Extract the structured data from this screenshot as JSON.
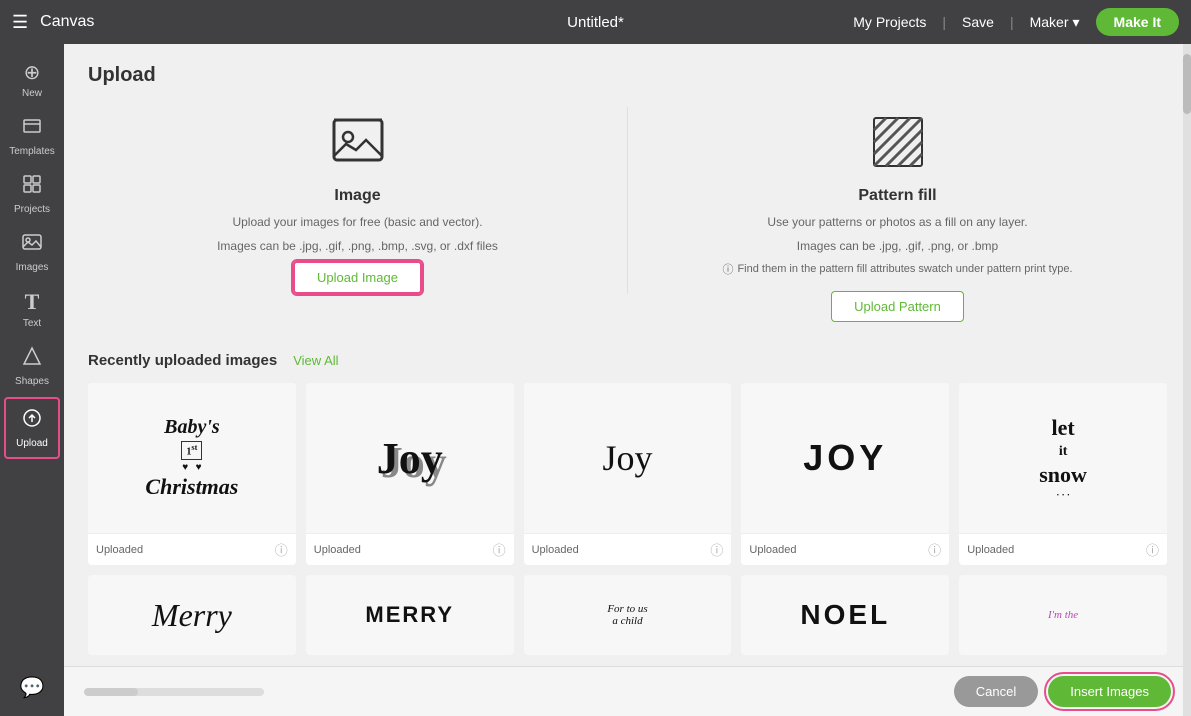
{
  "topbar": {
    "logo": "Canvas",
    "title": "Untitled*",
    "my_projects": "My Projects",
    "save": "Save",
    "maker_label": "Maker",
    "make_it": "Make It",
    "menu_icon": "☰"
  },
  "sidebar": {
    "items": [
      {
        "id": "new",
        "label": "New",
        "icon": "⊕"
      },
      {
        "id": "templates",
        "label": "Templates",
        "icon": "👕"
      },
      {
        "id": "projects",
        "label": "Projects",
        "icon": "⊞"
      },
      {
        "id": "images",
        "label": "Images",
        "icon": "🖼"
      },
      {
        "id": "text",
        "label": "Text",
        "icon": "T"
      },
      {
        "id": "shapes",
        "label": "Shapes",
        "icon": "✦"
      },
      {
        "id": "upload",
        "label": "Upload",
        "icon": "↑"
      }
    ]
  },
  "upload": {
    "title": "Upload",
    "image": {
      "title": "Image",
      "desc1": "Upload your images for free (basic and vector).",
      "desc2": "Images can be .jpg, .gif, .png, .bmp, .svg, or .dxf files",
      "btn_label": "Upload Image"
    },
    "pattern": {
      "title": "Pattern fill",
      "desc1": "Use your patterns or photos as a fill on any layer.",
      "desc2": "Images can be .jpg, .gif, .png, or .bmp",
      "info": "Find them in the pattern fill attributes swatch under pattern print type.",
      "btn_label": "Upload Pattern"
    },
    "recent_title": "Recently uploaded images",
    "view_all": "View All",
    "uploaded_label": "Uploaded",
    "images": [
      {
        "id": 1,
        "thumb": "christmas",
        "label": "Uploaded"
      },
      {
        "id": 2,
        "thumb": "joy1",
        "label": "Uploaded"
      },
      {
        "id": 3,
        "thumb": "joy2",
        "label": "Uploaded"
      },
      {
        "id": 4,
        "thumb": "joy3",
        "label": "Uploaded"
      },
      {
        "id": 5,
        "thumb": "letitsnow",
        "label": "Uploaded"
      },
      {
        "id": 6,
        "thumb": "merry",
        "label": ""
      },
      {
        "id": 7,
        "thumb": "merrybig",
        "label": ""
      },
      {
        "id": 8,
        "thumb": "gift",
        "label": ""
      },
      {
        "id": 9,
        "thumb": "noel",
        "label": ""
      },
      {
        "id": 10,
        "thumb": "cursive",
        "label": ""
      }
    ]
  },
  "bottom": {
    "cancel_label": "Cancel",
    "insert_label": "Insert Images"
  },
  "icons": {
    "info": "ⓘ",
    "chevron": "▾"
  }
}
